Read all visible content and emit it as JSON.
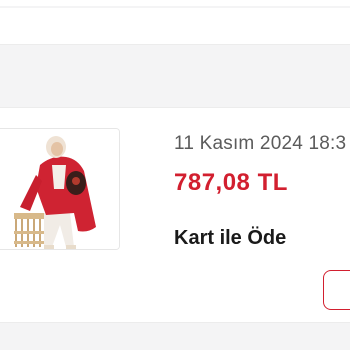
{
  "order": {
    "date": "11 Kasım 2024 18:3",
    "price": "787,08 TL",
    "payment_label": "Kart ile Öde",
    "thumbnail_icon": "product-photo-red-coat"
  },
  "colors": {
    "accent": "#d21f2f",
    "background": "#f4f4f5",
    "card": "#ffffff"
  }
}
